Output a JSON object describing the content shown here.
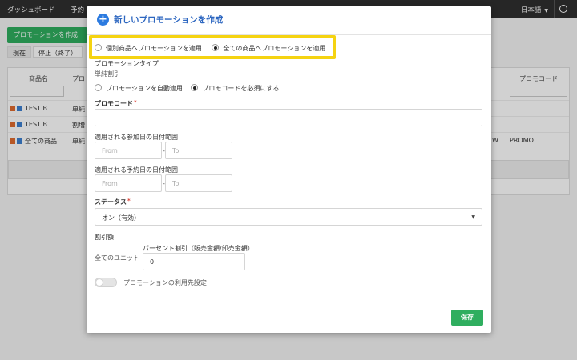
{
  "nav": {
    "items": [
      "ダッシュボード",
      "予約"
    ],
    "language": "日本語"
  },
  "background": {
    "create_button": "プロモーションを作成",
    "tabs": [
      "現在",
      "停止（終了）"
    ],
    "table": {
      "headers": [
        "商品名",
        "プロ",
        "プロモコード"
      ],
      "rows": [
        {
          "product": "TEST B",
          "type": "単純",
          "extra": "",
          "code": ""
        },
        {
          "product": "TEST B",
          "type": "割増",
          "extra": "",
          "code": ""
        },
        {
          "product": "全ての商品",
          "type": "単純",
          "extra": "W...",
          "code": "PROMO"
        }
      ]
    }
  },
  "modal": {
    "title": "新しいプロモーションを作成",
    "scope": {
      "options": [
        "個別商品へプロモーションを適用",
        "全ての商品へプロモーションを適用"
      ],
      "selected_index": 1
    },
    "promotion_type": {
      "label": "プロモーションタイプ",
      "value": "単純割引"
    },
    "code_mode": {
      "options": [
        "プロモーションを自動適用",
        "プロモコードを必須にする"
      ],
      "selected_index": 1
    },
    "promo_code": {
      "label": "プロモコード",
      "required_mark": "*",
      "value": ""
    },
    "participation_range": {
      "label": "適用される参加日の日付範囲",
      "from_placeholder": "From",
      "to_placeholder": "To",
      "separator": "-"
    },
    "booking_range": {
      "label": "適用される予約日の日付範囲",
      "from_placeholder": "From",
      "to_placeholder": "To",
      "separator": "-"
    },
    "status": {
      "label": "ステータス",
      "required_mark": "*",
      "value": "オン（有効）"
    },
    "discount": {
      "label": "割引額",
      "unit_label": "全てのユニット",
      "percent_label": "パーセント割引（販売金額/卸売金額）",
      "value": "0"
    },
    "usage_toggle": {
      "label": "プロモーションの利用先設定",
      "on": false
    },
    "save_label": "保存"
  },
  "colors": {
    "accent_blue": "#2c66c0",
    "save_green": "#2fae5f",
    "highlight_yellow": "#f5d311",
    "required_red": "#d9362b"
  }
}
